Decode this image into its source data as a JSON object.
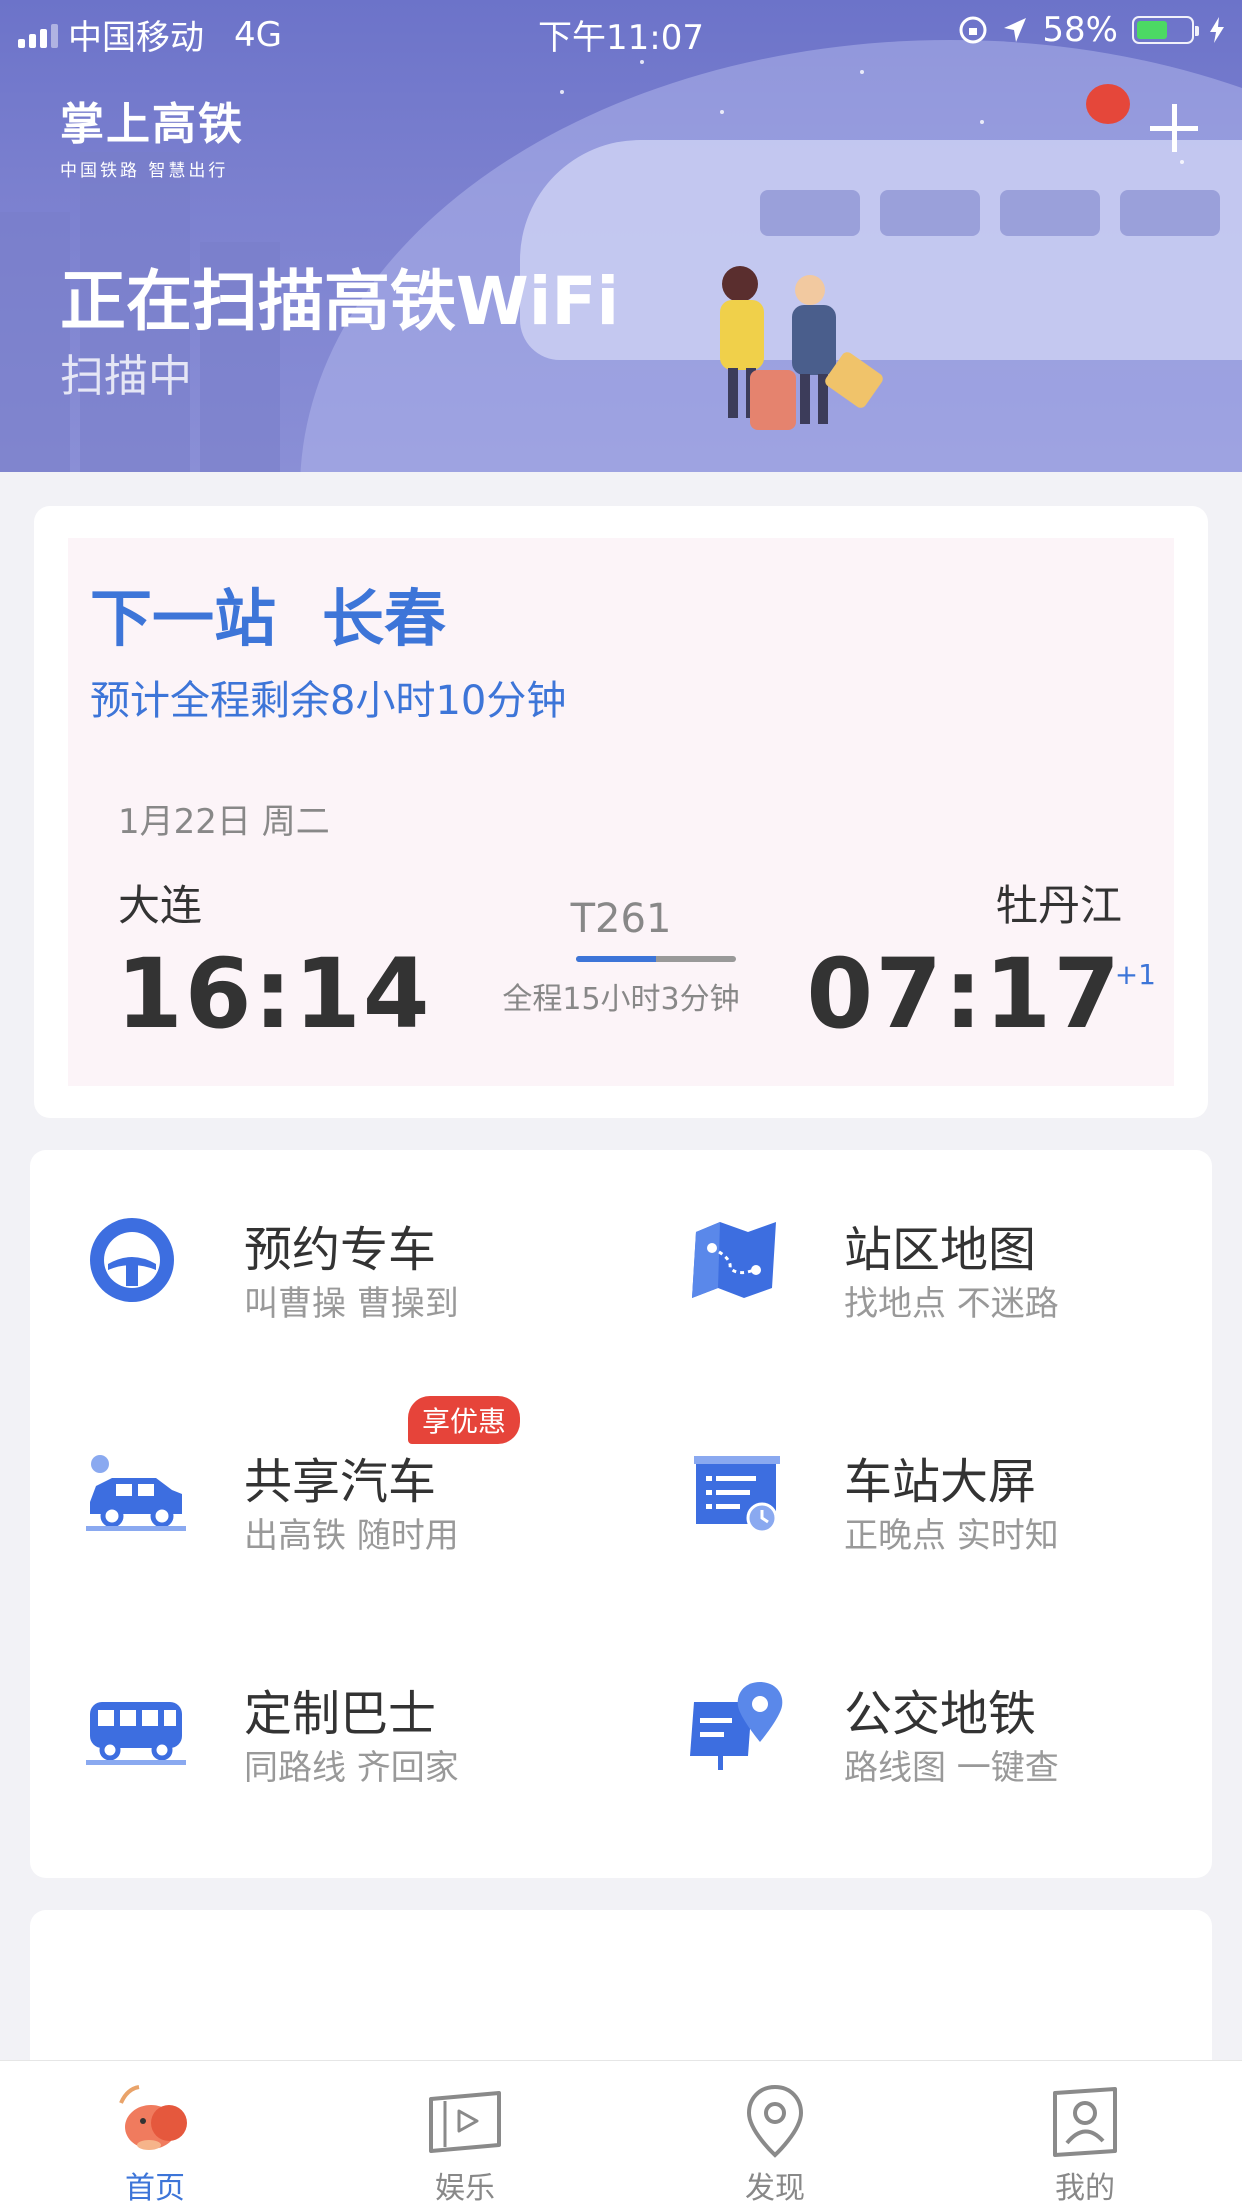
{
  "status_bar": {
    "carrier": "中国移动",
    "network": "4G",
    "time": "下午11:07",
    "battery": "58%",
    "battery_level": 0.58
  },
  "header": {
    "app_name": "掌上高铁",
    "app_tagline": "中国铁路 智慧出行",
    "title": "正在扫描高铁WiFi",
    "subtitle": "扫描中"
  },
  "trip": {
    "next_label": "下一站",
    "next_station": "长春",
    "remaining": "预计全程剩余8小时10分钟",
    "date": "1月22日 周二",
    "from_city": "大连",
    "from_time": "16:14",
    "to_city": "牡丹江",
    "to_time": "07:17",
    "day_offset": "+1",
    "train_no": "T261",
    "duration": "全程15小时3分钟",
    "progress": 0.5
  },
  "services": [
    {
      "title": "预约专车",
      "desc": "叫曹操 曹操到",
      "icon": "steering-wheel-icon"
    },
    {
      "title": "站区地图",
      "desc": "找地点 不迷路",
      "icon": "folded-map-icon"
    },
    {
      "title": "共享汽车",
      "desc": "出高铁 随时用",
      "icon": "car-icon",
      "badge": "享优惠"
    },
    {
      "title": "车站大屏",
      "desc": "正晚点 实时知",
      "icon": "station-screen-icon"
    },
    {
      "title": "定制巴士",
      "desc": "同路线 齐回家",
      "icon": "bus-icon"
    },
    {
      "title": "公交地铁",
      "desc": "路线图 一键查",
      "icon": "transit-map-pin-icon"
    }
  ],
  "tabs": [
    {
      "label": "首页",
      "icon": "home-mascot-icon",
      "active": true
    },
    {
      "label": "娱乐",
      "icon": "video-play-icon",
      "active": false
    },
    {
      "label": "发现",
      "icon": "location-pin-icon",
      "active": false
    },
    {
      "label": "我的",
      "icon": "profile-card-icon",
      "active": false
    }
  ],
  "colors": {
    "accent": "#3d75d8",
    "badge": "#e6443a",
    "header": "#7b80cf"
  }
}
